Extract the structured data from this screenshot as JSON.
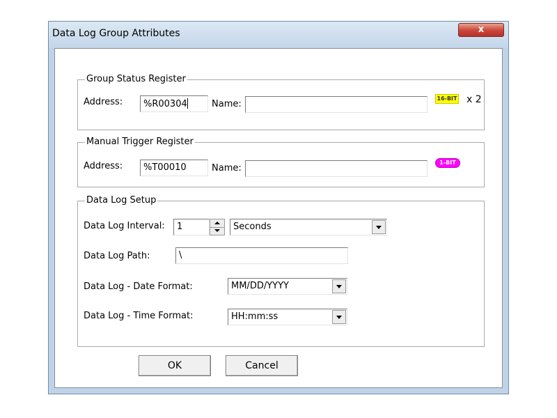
{
  "dialog": {
    "title": "Data Log Group Attributes",
    "close_label": "x"
  },
  "group_status": {
    "legend": "Group Status Register",
    "address_label": "Address:",
    "address_value": "%R00304",
    "name_label": "Name:",
    "name_value": "",
    "badge": "16-BIT",
    "multiplier": "x 2"
  },
  "manual_trigger": {
    "legend": "Manual Trigger Register",
    "address_label": "Address:",
    "address_value": "%T00010",
    "name_label": "Name:",
    "name_value": "",
    "badge": "1-BIT"
  },
  "setup": {
    "legend": "Data Log Setup",
    "interval_label": "Data Log Interval:",
    "interval_value": "1",
    "interval_unit": "Seconds",
    "path_label": "Data Log Path:",
    "path_value": "\\",
    "date_format_label": "Data Log  -  Date Format:",
    "date_format_value": "MM/DD/YYYY",
    "time_format_label": "Data Log  -  Time Format:",
    "time_format_value": "HH:mm:ss"
  },
  "buttons": {
    "ok": "OK",
    "cancel": "Cancel"
  },
  "colors": {
    "badge_16bit": "#ffff00",
    "badge_1bit": "#ff00ff",
    "close_button": "#c9453a"
  }
}
